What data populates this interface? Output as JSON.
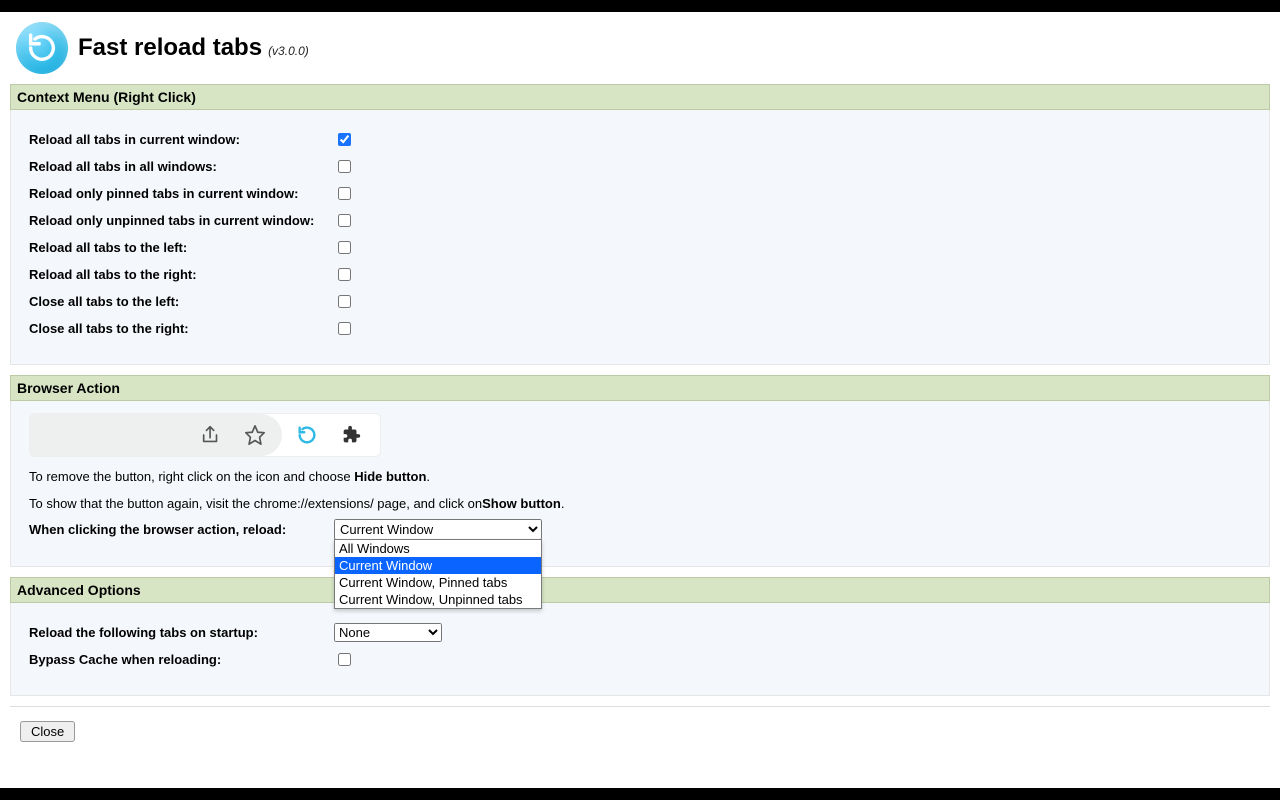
{
  "header": {
    "title": "Fast reload tabs",
    "version": "(v3.0.0)"
  },
  "sections": {
    "context_menu": {
      "title": "Context Menu (Right Click)",
      "options": [
        {
          "label": "Reload all tabs in current window:",
          "checked": true
        },
        {
          "label": "Reload all tabs in all windows:",
          "checked": false
        },
        {
          "label": "Reload only pinned tabs in current window:",
          "checked": false
        },
        {
          "label": "Reload only unpinned tabs in current window:",
          "checked": false
        },
        {
          "label": "Reload all tabs to the left:",
          "checked": false
        },
        {
          "label": "Reload all tabs to the right:",
          "checked": false
        },
        {
          "label": "Close all tabs to the left:",
          "checked": false
        },
        {
          "label": "Close all tabs to the right:",
          "checked": false
        }
      ]
    },
    "browser_action": {
      "title": "Browser Action",
      "desc1_pre": "To remove the button, right click on the icon and choose ",
      "desc1_bold": "Hide button",
      "desc1_post": ".",
      "desc2_pre": "To show that the button again, visit the chrome://extensions/ page, and click on",
      "desc2_bold": "Show button",
      "desc2_post": ".",
      "select_label": "When clicking the browser action, reload:",
      "selected": "Current Window",
      "options": [
        "All Windows",
        "Current Window",
        "Current Window, Pinned tabs",
        "Current Window, Unpinned tabs"
      ],
      "highlight_index": 1
    },
    "advanced": {
      "title": "Advanced Options",
      "startup_label": "Reload the following tabs on startup:",
      "startup_selected": "None",
      "bypass_label": "Bypass Cache when reloading:",
      "bypass_checked": false
    }
  },
  "footer": {
    "close": "Close"
  },
  "icons": {
    "share": "share-icon",
    "star": "star-icon",
    "reload": "reload-icon",
    "puzzle": "puzzle-icon"
  }
}
